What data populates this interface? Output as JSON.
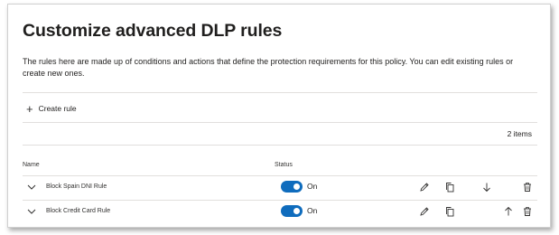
{
  "page": {
    "title": "Customize advanced DLP rules",
    "description": "The rules here are made up of conditions and actions that define the protection requirements for this policy. You can edit existing rules or create new ones."
  },
  "toolbar": {
    "create_rule_label": "Create rule"
  },
  "list": {
    "item_count": "2 items",
    "columns": {
      "name": "Name",
      "status": "Status"
    },
    "rows": [
      {
        "name": "Block Spain DNI Rule",
        "status": "On",
        "enabled": true,
        "move": "down"
      },
      {
        "name": "Block Credit Card Rule",
        "status": "On",
        "enabled": true,
        "move": "up"
      }
    ]
  },
  "colors": {
    "toggle_on": "#0f6cbd",
    "text": "#201f1e",
    "divider": "#e1dfdd"
  },
  "icons": {
    "create": "plus-icon",
    "expand": "chevron-down-icon",
    "edit": "pencil-icon",
    "copy": "copy-icon",
    "move_down": "arrow-down-icon",
    "move_up": "arrow-up-icon",
    "delete": "trash-icon"
  }
}
